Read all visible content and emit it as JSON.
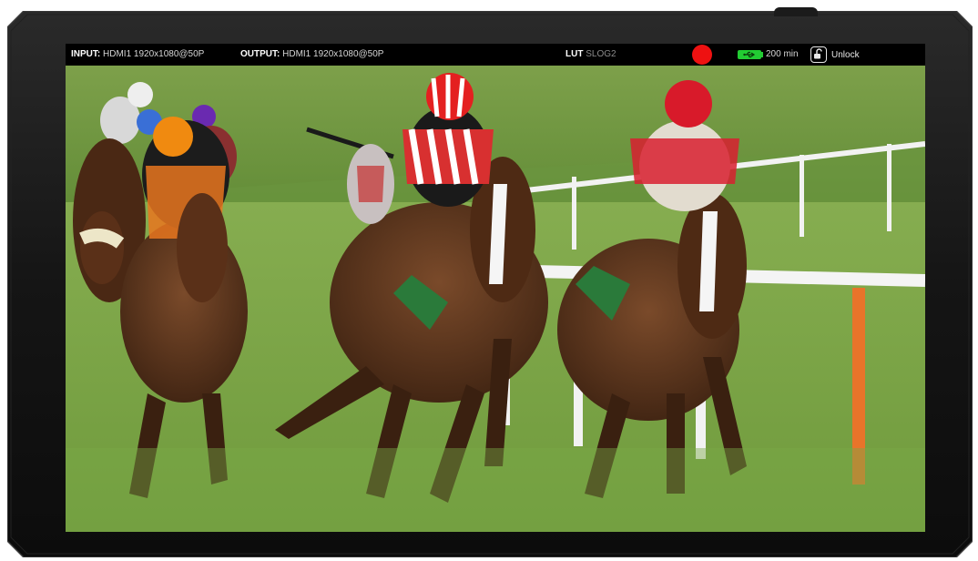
{
  "status": {
    "input_label": "INPUT:",
    "input_value": "HDMI1 1920x1080@50P",
    "output_label": "OUTPUT:",
    "output_value": "HDMI1 1920x1080@50P",
    "lut_label": "LUT",
    "lut_value": "SLOG2",
    "battery_text": "200 min",
    "lock_label": "Unlock"
  },
  "colors": {
    "record": "#ee1111",
    "battery": "#22cc33",
    "bezel": "#141414",
    "grass": "#6f9a3c",
    "rail": "#f2f2f2",
    "post_orange": "#e8742a"
  },
  "icons": {
    "record": "record-dot-icon",
    "battery": "usb-battery-icon",
    "lock": "unlock-padlock-icon"
  }
}
